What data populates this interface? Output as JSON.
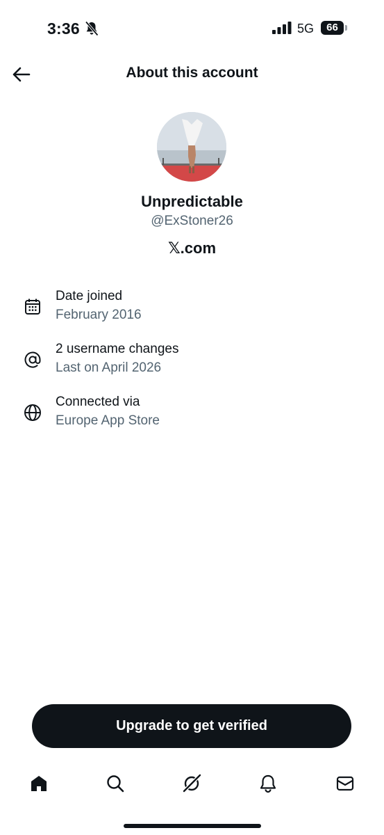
{
  "status_bar": {
    "time": "3:36",
    "network": "5G",
    "battery": "66"
  },
  "header": {
    "title": "About this account"
  },
  "profile": {
    "display_name": "Unpredictable",
    "handle": "@ExStoner26",
    "site": "𝕏.com"
  },
  "info": [
    {
      "icon": "calendar-icon",
      "title": "Date joined",
      "subtitle": "February 2016"
    },
    {
      "icon": "at-sign-icon",
      "title": "2 username changes",
      "subtitle": "Last on April 2026"
    },
    {
      "icon": "globe-icon",
      "title": "Connected via",
      "subtitle": "Europe App Store"
    }
  ],
  "cta": {
    "label": "Upgrade to get verified"
  },
  "tabbar": {
    "items": [
      "home-icon",
      "search-icon",
      "grok-icon",
      "notifications-icon",
      "messages-icon"
    ]
  },
  "colors": {
    "text_primary": "#0f1419",
    "text_secondary": "#536471",
    "button_bg": "#0f1419",
    "background": "#ffffff"
  }
}
